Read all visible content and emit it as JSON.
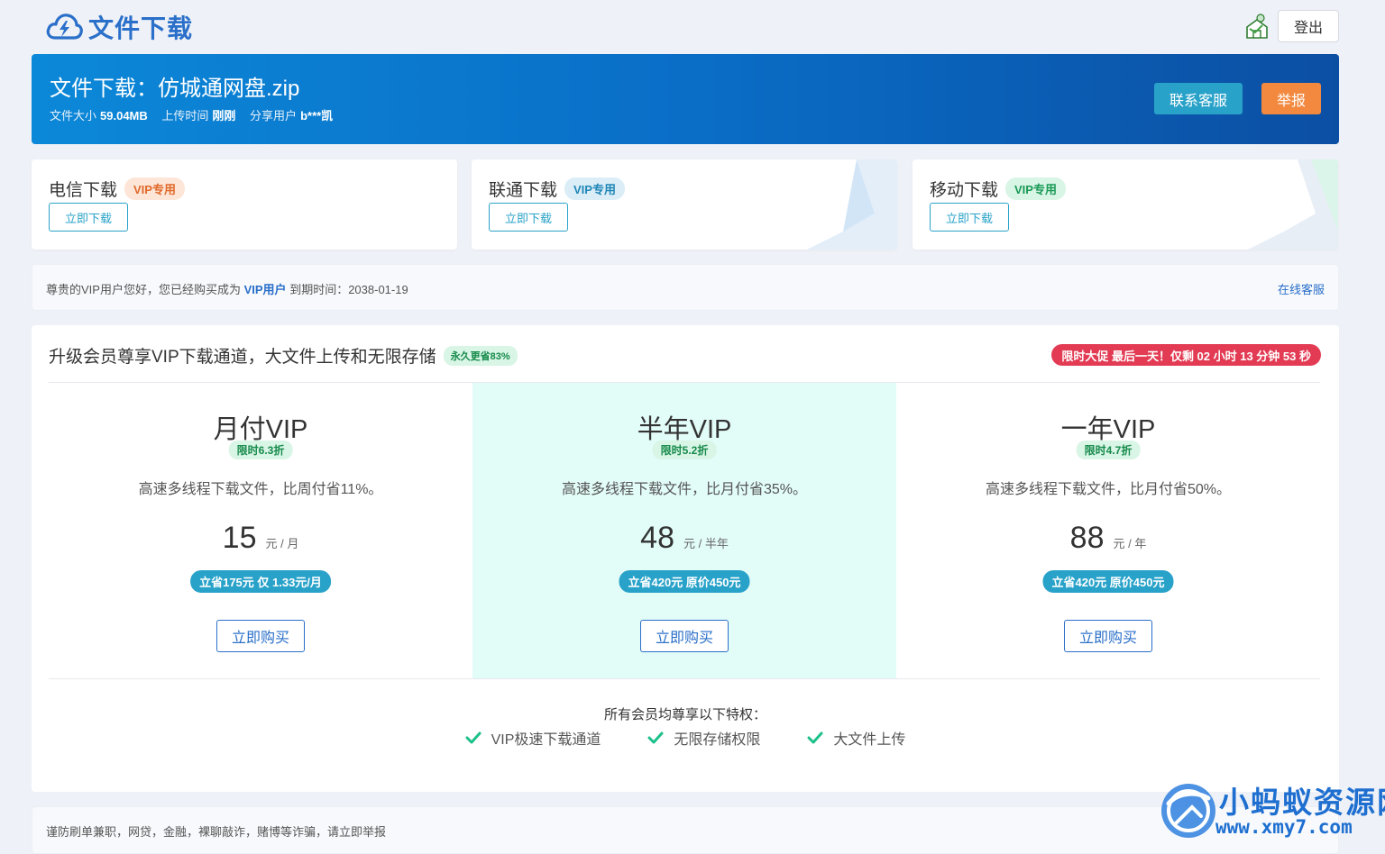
{
  "header": {
    "logo_text": "文件下载",
    "logout_label": "登出"
  },
  "file": {
    "title": "文件下载：仿城通网盘.zip",
    "size_label": "文件大小",
    "size_value": "59.04MB",
    "upload_label": "上传时间",
    "upload_value": "刚刚",
    "share_label": "分享用户",
    "share_value": "b***凯",
    "contact_label": "联系客服",
    "report_label": "举报"
  },
  "downloads": [
    {
      "title": "电信下载",
      "badge": "VIP专用",
      "button": "立即下载"
    },
    {
      "title": "联通下载",
      "badge": "VIP专用",
      "button": "立即下载"
    },
    {
      "title": "移动下载",
      "badge": "VIP专用",
      "button": "立即下载"
    }
  ],
  "vip_notice": {
    "prefix": "尊贵的VIP用户您好，您已经购买成为",
    "highlight": "VIP用户",
    "expiry_label": "到期时间：",
    "expiry_value": "2038-01-19",
    "online_label": "在线客服"
  },
  "upgrade": {
    "title": "升级会员尊享VIP下载通道，大文件上传和无限存储",
    "save_badge": "永久更省83%",
    "promo": "限时大促 最后一天！仅剩 02 小时 13 分钟 53 秒",
    "plans": [
      {
        "name": "月付VIP",
        "discount": "限时6.3折",
        "desc": "高速多线程下载文件，比周付省11%。",
        "price": "15",
        "unit": "元 / 月",
        "save": "立省175元 仅 1.33元/月",
        "button": "立即购买"
      },
      {
        "name": "半年VIP",
        "discount": "限时5.2折",
        "desc": "高速多线程下载文件，比月付省35%。",
        "price": "48",
        "unit": "元 / 半年",
        "save": "立省420元 原价450元",
        "button": "立即购买"
      },
      {
        "name": "一年VIP",
        "discount": "限时4.7折",
        "desc": "高速多线程下载文件，比月付省50%。",
        "price": "88",
        "unit": "元 / 年",
        "save": "立省420元 原价450元",
        "button": "立即购买"
      }
    ],
    "perks_title": "所有会员均尊享以下特权：",
    "perks": [
      "VIP极速下载通道",
      "无限存储权限",
      "大文件上传"
    ]
  },
  "warning": "谨防刷单兼职，网贷，金融，裸聊敲诈，赌博等诈骗，请立即举报",
  "watermark": {
    "title": "小蚂蚁资源网",
    "url": "www.xmy7.com"
  },
  "colors": {
    "primary": "#2a6fc9",
    "accent_teal": "#29a2c9",
    "report_orange": "#f2893f",
    "promo_red": "#e23b53",
    "featured_bg": "#e2fcf8",
    "check_green": "#1cc08a"
  },
  "icons": {
    "logo": "cloud-lightning-icon",
    "avatar": "user-avatar-icon",
    "check": "check-icon"
  }
}
